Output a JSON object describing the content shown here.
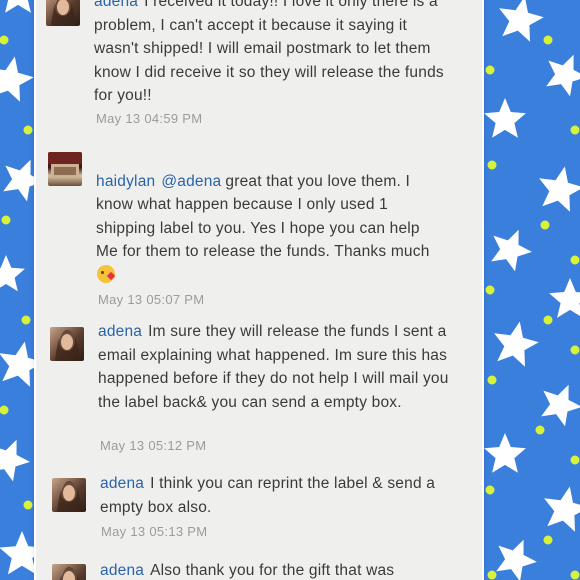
{
  "comments": [
    {
      "user": "adena",
      "mention": "",
      "text": "I received it today!! I love it only there is a problem, I can't accept it because it saying it wasn't shipped! I will email postmark to let them know I did receive it so they will release the funds for you!!",
      "timestamp": "May 13 04:59 PM",
      "avatar": "avatar-photo-woman"
    },
    {
      "user": "haidylan",
      "mention": "@adena",
      "text": "great that you love them. I know what happen because I only used 1 shipping label to you. Yes I hope you can help\nMe for them to release the funds. Thanks much",
      "emoji": "kissing-face-emoji",
      "timestamp": "May 13 05:07 PM",
      "avatar": "avatar-photo-product"
    },
    {
      "user": "adena",
      "mention": "",
      "text": "Im sure they will release the funds I sent a email explaining what happened. Im sure this has happened before if they do not help I will mail you the label back& you can send a empty box.",
      "timestamp": "May 13 05:12 PM",
      "avatar": "avatar-photo-woman"
    },
    {
      "user": "adena",
      "mention": "",
      "text": "I think you can reprint the label & send a empty box also.",
      "timestamp": "May 13 05:13 PM",
      "avatar": "avatar-photo-woman"
    },
    {
      "user": "adena",
      "mention": "",
      "text": "Also thank you for the gift that was",
      "timestamp": "",
      "avatar": "avatar-photo-woman"
    }
  ],
  "colors": {
    "background": "#3a7fdc",
    "panel": "#efefed",
    "username": "#2a63a8",
    "timestamp": "#9b9b9b",
    "star": "#ffffff",
    "dot": "#d8f23a"
  }
}
